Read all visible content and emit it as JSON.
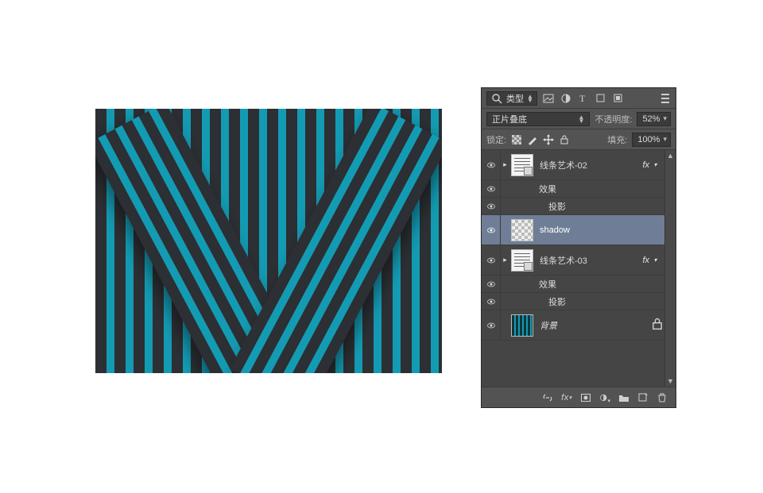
{
  "canvas": {
    "accent": "#139bb3",
    "bg": "#2c2f33"
  },
  "panel": {
    "filter": {
      "search_icon": "search",
      "type_label": "类型",
      "icons": [
        "filter-image-icon",
        "filter-adjust-icon",
        "filter-text-icon",
        "filter-shape-icon",
        "filter-smart-icon"
      ]
    },
    "blend": {
      "mode": "正片叠底",
      "opacity_label": "不透明度:",
      "opacity_value": "52%"
    },
    "locks": {
      "label": "锁定:",
      "fill_label": "填充:",
      "fill_value": "100%"
    },
    "layers": [
      {
        "id": "l1",
        "name": "线条艺术-02",
        "thumb": "smartobj",
        "fx": true,
        "expanded": true,
        "sub": [
          {
            "label": "效果",
            "eye": true
          },
          {
            "label": "投影",
            "eye": true
          }
        ]
      },
      {
        "id": "l2",
        "name": "shadow",
        "thumb": "checker",
        "selected": true
      },
      {
        "id": "l3",
        "name": "线条艺术-03",
        "thumb": "smartobj",
        "fx": true,
        "expanded": true,
        "sub": [
          {
            "label": "效果",
            "eye": true
          },
          {
            "label": "投影",
            "eye": true
          }
        ]
      },
      {
        "id": "l4",
        "name": "背景",
        "thumb": "stripes",
        "locked": true,
        "italic": true
      }
    ],
    "fx_text": "fx",
    "footer_icons": [
      "link-icon",
      "fx-menu-icon",
      "mask-icon",
      "adjust-icon",
      "group-icon",
      "new-layer-icon",
      "trash-icon"
    ]
  }
}
